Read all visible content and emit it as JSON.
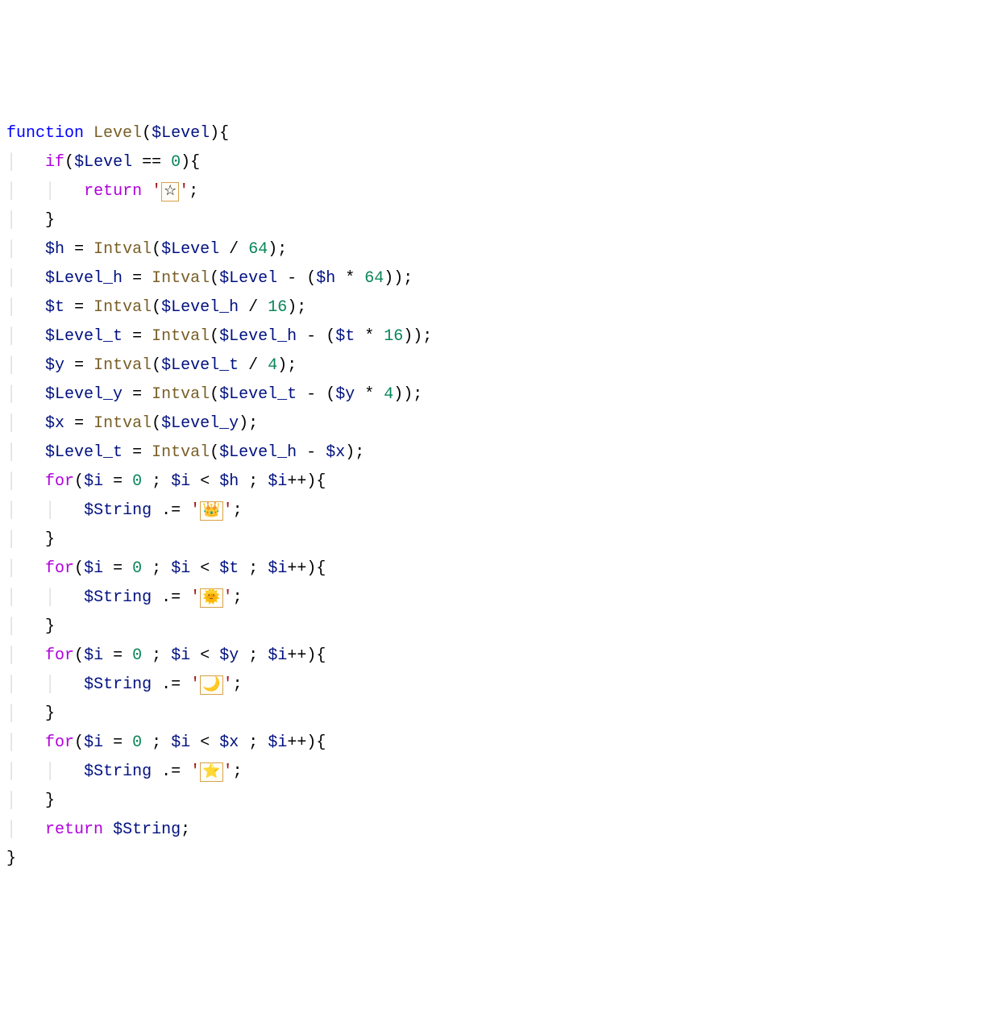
{
  "code": {
    "function_kw": "function",
    "function_name": "Level",
    "param": "$Level",
    "if_kw": "if",
    "return_kw": "return",
    "for_kw": "for",
    "Intval": "Intval",
    "vars": {
      "Level": "$Level",
      "h": "$h",
      "Level_h": "$Level_h",
      "t": "$t",
      "Level_t": "$Level_t",
      "y": "$y",
      "Level_y": "$Level_y",
      "x": "$x",
      "String": "$String",
      "i": "$i"
    },
    "numbers": {
      "zero": "0",
      "four": "4",
      "sixteen": "16",
      "sixty_four": "64"
    },
    "emojis": {
      "star_outline": "☆",
      "crown": "👑",
      "sun": "🌞",
      "moon": "🌙",
      "star": "⭐"
    }
  }
}
